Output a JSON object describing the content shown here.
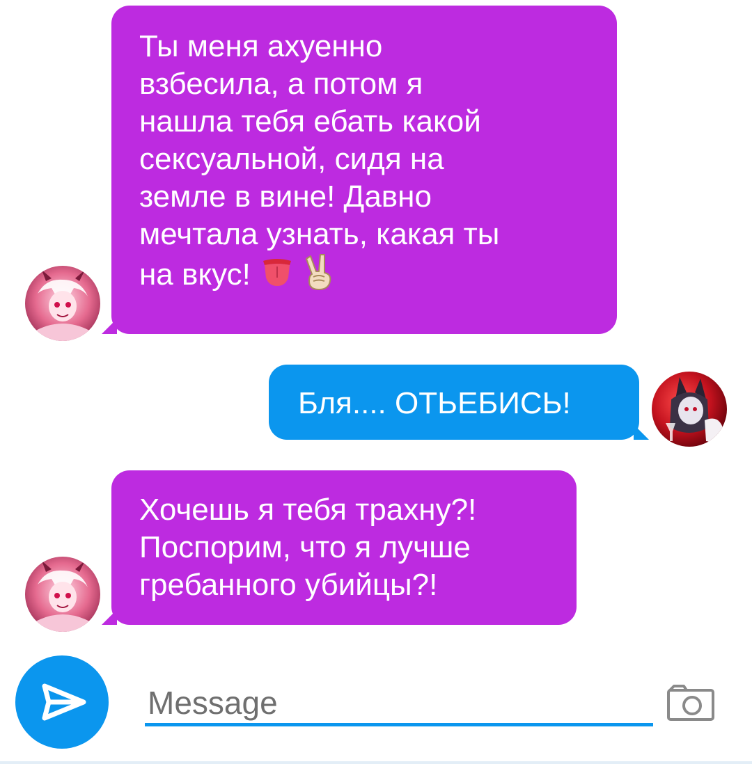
{
  "conversation": {
    "messages": [
      {
        "direction": "incoming",
        "lines": [
          "Ты меня ахуенно",
          "взбесила, а потом я",
          "нашла тебя ебать какой",
          "сексуальной, сидя на",
          "земле в вине! Давно",
          "мечтала узнать, какая ты",
          "на вкус!"
        ],
        "emojis": [
          "tongue-emoji",
          "victory-hand-emoji"
        ]
      },
      {
        "direction": "outgoing",
        "lines": [
          "Бля.... ОТЬЕБИСЬ!"
        ]
      },
      {
        "direction": "incoming",
        "lines": [
          "Хочешь я тебя трахну?!",
          "Поспорим, что я лучше",
          "гребанного убийцы?!"
        ]
      }
    ]
  },
  "composer": {
    "placeholder": "Message",
    "send_icon": "send-arrow-icon",
    "camera_icon": "camera-icon"
  },
  "colors": {
    "incoming_bubble": "#bd2be0",
    "outgoing_bubble": "#0b96ee",
    "accent": "#0b96ee"
  }
}
